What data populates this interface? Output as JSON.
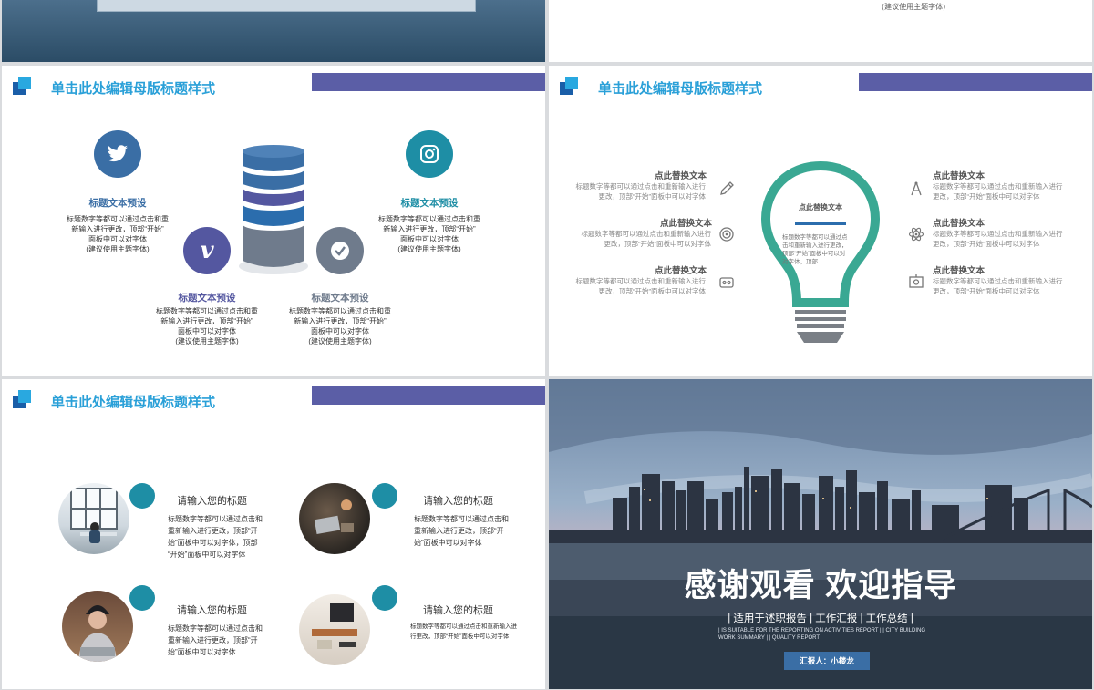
{
  "top_right": {
    "note": "(建议使用主题字体)"
  },
  "slide_title": "单击此处编辑母版标题样式",
  "slide1": {
    "items": [
      {
        "label": "标题文本预设",
        "desc": [
          "标题数字等都可以通过点击和重",
          "新输入进行更改，顶部“开始”",
          "面板中可以对字体",
          "(建议使用主题字体)"
        ]
      },
      {
        "label": "标题文本预设",
        "desc": [
          "标题数字等都可以通过点击和重",
          "新输入进行更改，顶部“开始”",
          "面板中可以对字体",
          "(建议使用主题字体)"
        ]
      },
      {
        "label": "标题文本预设",
        "desc": [
          "标题数字等都可以通过点击和重",
          "新输入进行更改，顶部“开始”",
          "面板中可以对字体",
          "(建议使用主题字体)"
        ]
      },
      {
        "label": "标题文本预设",
        "desc": [
          "标题数字等都可以通过点击和重",
          "新输入进行更改，顶部“开始”",
          "面板中可以对字体",
          "(建议使用主题字体)"
        ]
      }
    ],
    "colors": {
      "twitter": "#3a6ea5",
      "instagram": "#1e8ea5",
      "vimeo": "#5457a0",
      "check": "#6f7b8c"
    }
  },
  "slide2": {
    "bulb_title": "点此替换文本",
    "bulb_desc": [
      "标题数字等都可以通过点",
      "击和重新输入进行更改，",
      "顶部“开始”面板中可以对",
      "对字体，顶部"
    ],
    "left": [
      {
        "title": "点此替换文本",
        "desc": [
          "标题数字等都可以通过点击和重新输入进行",
          "更改，顶部“开始”面板中可以对字体"
        ],
        "icon": "pencil-icon"
      },
      {
        "title": "点此替换文本",
        "desc": [
          "标题数字等都可以通过点击和重新输入进行",
          "更改，顶部“开始”面板中可以对字体"
        ],
        "icon": "target-icon"
      },
      {
        "title": "点此替换文本",
        "desc": [
          "标题数字等都可以通过点击和重新输入进行",
          "更改，顶部“开始”面板中可以对字体"
        ],
        "icon": "briefcase-icon"
      }
    ],
    "right": [
      {
        "title": "点此替换文本",
        "desc": [
          "标题数字等都可以通过点击和重新输入进行",
          "更改，顶部“开始”面板中可以对字体"
        ],
        "icon": "compass-icon"
      },
      {
        "title": "点此替换文本",
        "desc": [
          "标题数字等都可以通过点击和重新输入进行",
          "更改，顶部“开始”面板中可以对字体"
        ],
        "icon": "atom-icon"
      },
      {
        "title": "点此替换文本",
        "desc": [
          "标题数字等都可以通过点击和重新输入进行",
          "更改，顶部“开始”面板中可以对字体"
        ],
        "icon": "presentation-icon"
      }
    ]
  },
  "slide3": {
    "items": [
      {
        "title": "请输入您的标题",
        "desc": [
          "标题数字等都可以通过点击和",
          "重新输入进行更改，顶部“开",
          "始”面板中可以对字体，顶部",
          "“开始”面板中可以对字体"
        ]
      },
      {
        "title": "请输入您的标题",
        "desc": [
          "标题数字等都可以通过点击和",
          "重新输入进行更改，顶部“开",
          "始”面板中可以对字体"
        ]
      },
      {
        "title": "请输入您的标题",
        "desc": [
          "标题数字等都可以通过点击和",
          "重新输入进行更改，顶部“开",
          "始”面板中可以对字体"
        ]
      },
      {
        "title": "请输入您的标题",
        "desc": [
          "标题数字等都可以通过点击和重新输入进",
          "行更改，顶部“开始”面板中可以对字体"
        ]
      }
    ]
  },
  "slide4": {
    "headline": "感谢观看 欢迎指导",
    "subtitle": "| 适用于述职报告 | 工作汇报 | 工作总结 |",
    "english": [
      "| IS SUITABLE FOR THE REPORTING ON ACTIVITIES REPORT | | CITY BUILDING",
      "WORK SUMMARY | | QUALITY REPORT"
    ],
    "reporter": "汇报人：小楼龙"
  }
}
